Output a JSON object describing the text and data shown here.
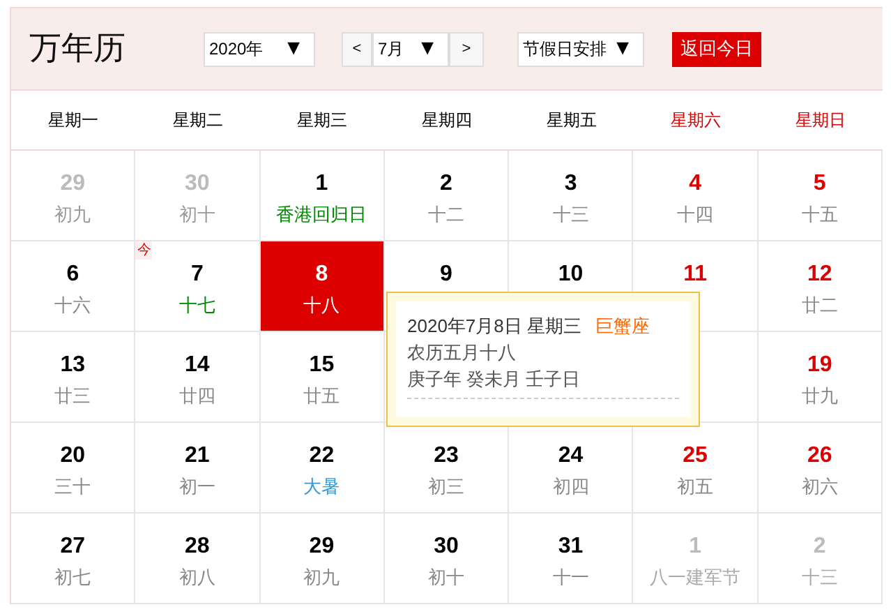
{
  "title": "万年历",
  "year_select": {
    "value": "2020年",
    "arrow": "▼"
  },
  "month_nav": {
    "prev": "<",
    "value": "7月",
    "arrow": "▼",
    "next": ">"
  },
  "holiday_select": {
    "value": "节假日安排",
    "arrow": "▼"
  },
  "today_button": "返回今日",
  "weekdays": [
    {
      "label": "星期一",
      "weekend": false
    },
    {
      "label": "星期二",
      "weekend": false
    },
    {
      "label": "星期三",
      "weekend": false
    },
    {
      "label": "星期四",
      "weekend": false
    },
    {
      "label": "星期五",
      "weekend": false
    },
    {
      "label": "星期六",
      "weekend": true
    },
    {
      "label": "星期日",
      "weekend": true
    }
  ],
  "days": [
    {
      "day": "29",
      "sub": "初九",
      "other_month": true,
      "selected": false,
      "color": "#999999"
    },
    {
      "day": "30",
      "sub": "初十",
      "other_month": true,
      "selected": false,
      "color": "#999999"
    },
    {
      "day": "1",
      "sub": "香港回归日",
      "other_month": false,
      "selected": false,
      "color": "#008800"
    },
    {
      "day": "2",
      "sub": "十二",
      "other_month": false,
      "selected": false,
      "color": "#888888"
    },
    {
      "day": "3",
      "sub": "十三",
      "other_month": false,
      "selected": false,
      "color": "#888888"
    },
    {
      "day": "4",
      "sub": "十四",
      "other_month": false,
      "selected": false,
      "color": "#888888"
    },
    {
      "day": "5",
      "sub": "十五",
      "other_month": false,
      "selected": false,
      "color": "#888888"
    },
    {
      "day": "6",
      "sub": "十六",
      "other_month": false,
      "selected": false,
      "color": "#888888"
    },
    {
      "day": "7",
      "sub": "十七",
      "other_month": false,
      "selected": false,
      "color": "#008800",
      "badge": "今"
    },
    {
      "day": "8",
      "sub": "十八",
      "other_month": false,
      "selected": true,
      "color": "#ffffff"
    },
    {
      "day": "9",
      "other_month": false,
      "selected": false
    },
    {
      "day": "10",
      "other_month": false,
      "selected": false
    },
    {
      "day": "11",
      "other_month": false,
      "selected": false
    },
    {
      "day": "12",
      "sub": "廿二",
      "other_month": false,
      "selected": false,
      "color": "#888888"
    },
    {
      "day": "13",
      "sub": "廿三",
      "other_month": false,
      "selected": false,
      "color": "#888888"
    },
    {
      "day": "14",
      "sub": "廿四",
      "other_month": false,
      "selected": false,
      "color": "#888888"
    },
    {
      "day": "15",
      "sub": "廿五",
      "other_month": false,
      "selected": false,
      "color": "#888888"
    },
    {
      "selected": false
    },
    {
      "day": "19",
      "sub": "廿九",
      "other_month": false,
      "selected": false,
      "color": "#888888"
    },
    {
      "day": "20",
      "sub": "三十",
      "other_month": false,
      "selected": false,
      "color": "#888888"
    },
    {
      "day": "21",
      "sub": "初一",
      "other_month": false,
      "selected": false,
      "color": "#888888"
    },
    {
      "day": "22",
      "sub": "大暑",
      "other_month": false,
      "selected": false,
      "color": "#3399dd"
    },
    {
      "day": "23",
      "sub": "初三",
      "other_month": false,
      "selected": false,
      "color": "#888888"
    },
    {
      "day": "24",
      "sub": "初四",
      "other_month": false,
      "selected": false,
      "color": "#888888"
    },
    {
      "day": "25",
      "sub": "初五",
      "other_month": false,
      "selected": false,
      "color": "#888888"
    },
    {
      "day": "26",
      "sub": "初六",
      "other_month": false,
      "selected": false,
      "color": "#888888"
    },
    {
      "day": "27",
      "sub": "初七",
      "other_month": false,
      "selected": false,
      "color": "#888888"
    },
    {
      "day": "28",
      "sub": "初八",
      "other_month": false,
      "selected": false,
      "color": "#888888"
    },
    {
      "day": "29",
      "sub": "初九",
      "other_month": false,
      "selected": false,
      "color": "#888888"
    },
    {
      "day": "30",
      "sub": "初十",
      "other_month": false,
      "selected": false,
      "color": "#888888"
    },
    {
      "day": "31",
      "sub": "十一",
      "other_month": false,
      "selected": false,
      "color": "#888888"
    },
    {
      "day": "1",
      "sub": "八一建军节",
      "other_month": true,
      "selected": false,
      "color": "#aaaaaa"
    },
    {
      "day": "2",
      "sub": "十三",
      "other_month": true,
      "selected": false,
      "color": "#aaaaaa"
    }
  ],
  "tooltip": {
    "date": "2020年7月8日 星期三",
    "sign": "巨蟹座",
    "lunar": "农历五月十八",
    "ganzhi": "庚子年 癸未月 壬子日"
  }
}
